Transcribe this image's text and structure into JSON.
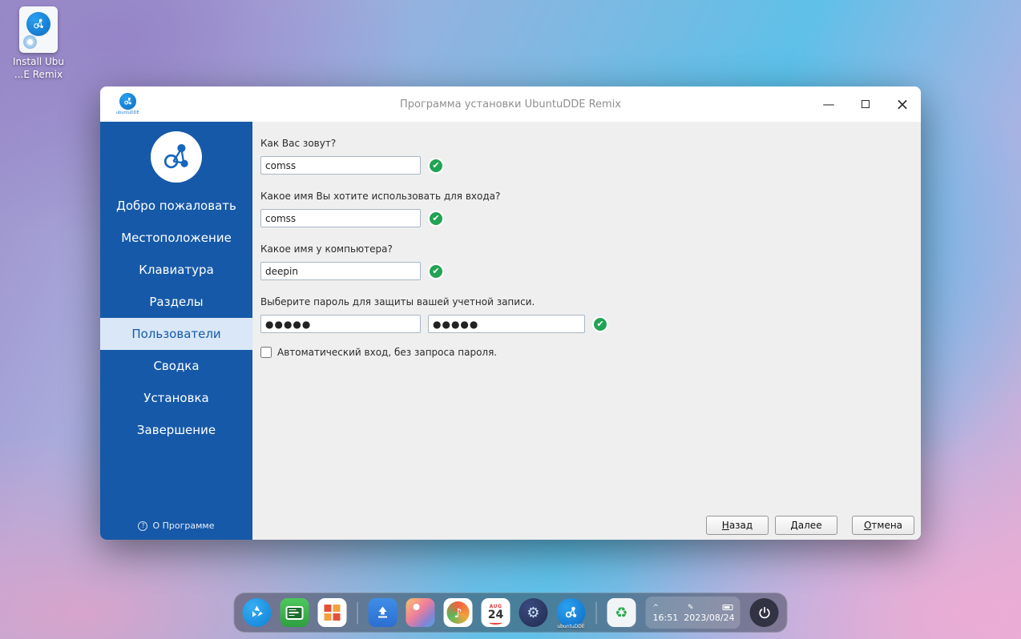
{
  "desktop": {
    "install_icon": {
      "label_line1": "Install Ubu",
      "label_line2": "...E Remix"
    }
  },
  "titlebar": {
    "title": "Программа установки UbuntuDDE Remix",
    "logo_label": "ubuntuDDE",
    "controls": {
      "minimize": "—",
      "close": "×"
    }
  },
  "sidebar": {
    "items": [
      {
        "label": "Добро пожаловать"
      },
      {
        "label": "Местоположение"
      },
      {
        "label": "Клавиатура"
      },
      {
        "label": "Разделы"
      },
      {
        "label": "Пользователи"
      },
      {
        "label": "Сводка"
      },
      {
        "label": "Установка"
      },
      {
        "label": "Завершение"
      }
    ],
    "active_item": "Пользователи",
    "about_label": "О Программе",
    "about_icon_glyph": "?"
  },
  "form": {
    "name_label": "Как Вас зовут?",
    "name_value": "comss",
    "login_label": "Какое имя Вы хотите использовать для входа?",
    "login_value": "comss",
    "hostname_label": "Какое имя у компьютера?",
    "hostname_value": "deepin",
    "password_label": "Выберите пароль для защиты вашей учетной записи.",
    "password_value": "●●●●●",
    "password_confirm_value": "●●●●●",
    "autologin_label": "Автоматический вход, без запроса пароля."
  },
  "footer": {
    "back": "Назад",
    "next": "Далее",
    "cancel": "Отмена"
  },
  "dock": {
    "calendar": {
      "month": "AUG",
      "day": "24"
    },
    "ubuntudde_label": "ubuntuDDE",
    "clock": {
      "time": "16:51",
      "date": "2023/08/24"
    }
  },
  "icons": {
    "check": "✔",
    "chevron_up": "^",
    "pen": "✎",
    "gear": "⚙",
    "recycle": "♻",
    "music_note": "♪"
  },
  "colors": {
    "sidebar_blue": "#1659a8",
    "accent_green": "#22a355",
    "titlebar_bg": "#ffffff",
    "content_bg": "#efefef"
  }
}
